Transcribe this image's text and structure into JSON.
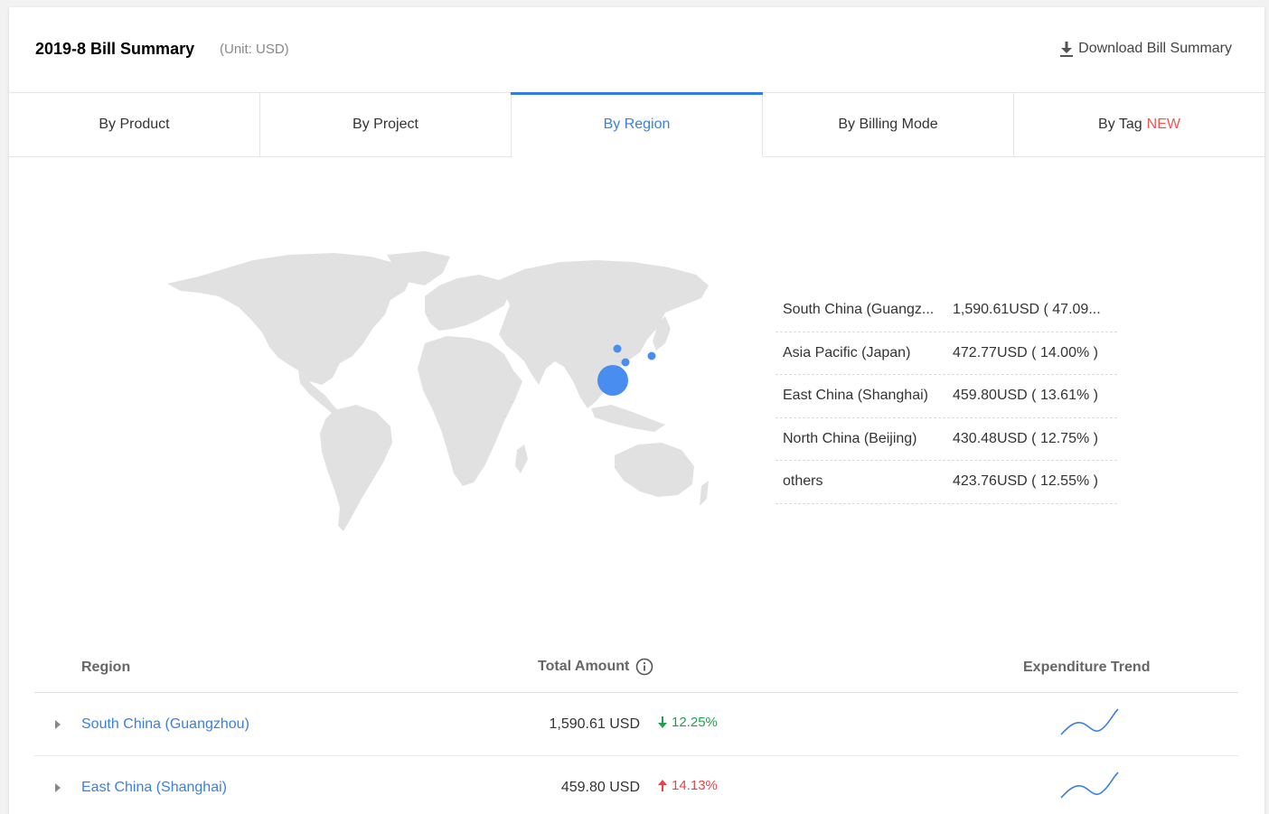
{
  "header": {
    "title": "2019-8 Bill Summary",
    "unit": "(Unit: USD)",
    "download_label": "Download Bill Summary"
  },
  "tabs": [
    {
      "label": "By Product",
      "active": false
    },
    {
      "label": "By Project",
      "active": false
    },
    {
      "label": "By Region",
      "active": true
    },
    {
      "label": "By Billing Mode",
      "active": false
    },
    {
      "label": "By Tag",
      "badge": "NEW",
      "active": false
    }
  ],
  "legend": [
    {
      "name": "South China (Guangz...",
      "value": "1,590.61USD ( 47.09..."
    },
    {
      "name": "Asia Pacific (Japan)",
      "value": "472.77USD ( 14.00% )"
    },
    {
      "name": "East China (Shanghai)",
      "value": "459.80USD ( 13.61% )"
    },
    {
      "name": "North China (Beijing)",
      "value": "430.48USD ( 12.75% )"
    },
    {
      "name": "others",
      "value": "423.76USD ( 12.55% )"
    }
  ],
  "table": {
    "columns": {
      "region": "Region",
      "total": "Total Amount",
      "trend": "Expenditure Trend"
    },
    "rows": [
      {
        "region": "South China (Guangzhou)",
        "amount": "1,590.61 USD",
        "change": "12.25%",
        "direction": "down"
      },
      {
        "region": "East China (Shanghai)",
        "amount": "459.80 USD",
        "change": "14.13%",
        "direction": "up"
      }
    ]
  },
  "colors": {
    "accent": "#2f7de1",
    "link": "#3b7fe0",
    "badge_new": "#f25555",
    "trend_down": "#1fa14b",
    "trend_up": "#e54545",
    "map_land": "#e1e1e1",
    "map_bubble": "#4a8df0"
  }
}
